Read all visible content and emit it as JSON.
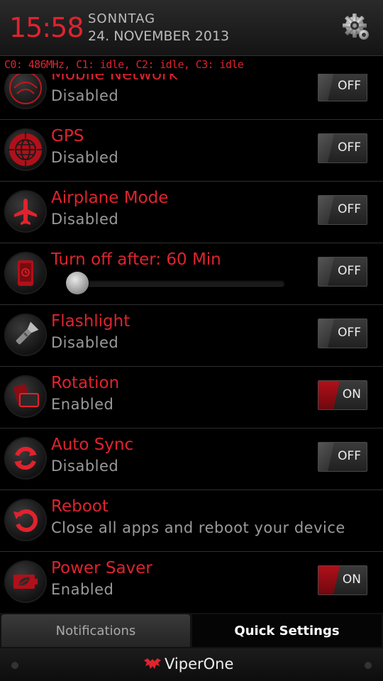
{
  "header": {
    "time": "15:58",
    "day": "SONNTAG",
    "date": "24. NOVEMBER 2013"
  },
  "cpu_status": "C0: 486MHz, C1: idle, C2: idle, C3: idle",
  "rows": [
    {
      "title": "Mobile Network",
      "subtitle": "Disabled",
      "toggle": "OFF",
      "icon": "mobile-network-icon"
    },
    {
      "title": "GPS",
      "subtitle": "Disabled",
      "toggle": "OFF",
      "icon": "gps-globe-icon"
    },
    {
      "title": "Airplane Mode",
      "subtitle": "Disabled",
      "toggle": "OFF",
      "icon": "airplane-icon"
    },
    {
      "title": "Turn off after: 60 Min",
      "subtitle": "",
      "toggle": "OFF",
      "icon": "screen-timeout-icon",
      "slider_value": 0
    },
    {
      "title": "Flashlight",
      "subtitle": "Disabled",
      "toggle": "OFF",
      "icon": "flashlight-icon"
    },
    {
      "title": "Rotation",
      "subtitle": "Enabled",
      "toggle": "ON",
      "icon": "rotation-icon"
    },
    {
      "title": "Auto Sync",
      "subtitle": "Disabled",
      "toggle": "OFF",
      "icon": "sync-icon"
    },
    {
      "title": "Reboot",
      "subtitle": "Close all apps and reboot your device",
      "icon": "reboot-icon"
    },
    {
      "title": "Power Saver",
      "subtitle": "Enabled",
      "toggle": "ON",
      "icon": "battery-leaf-icon"
    }
  ],
  "tabs": {
    "notifications": "Notifications",
    "quick_settings": "Quick Settings"
  },
  "footer": {
    "brand": "ViperOne"
  },
  "colors": {
    "accent": "#e0232e",
    "background": "#000000",
    "subtitle": "#9a9a9a"
  }
}
